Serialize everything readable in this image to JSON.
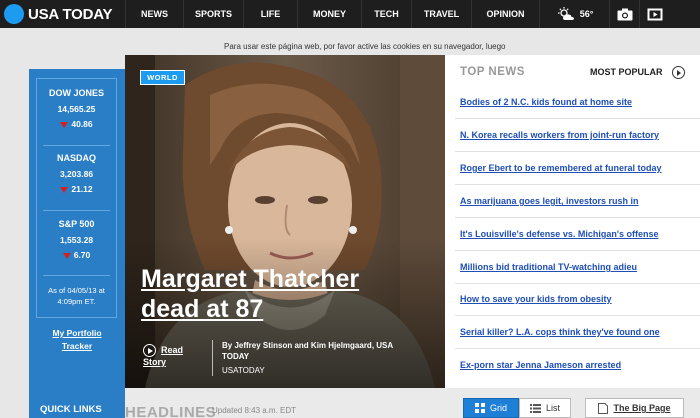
{
  "header": {
    "logo_text": "USA TODAY",
    "nav": [
      "NEWS",
      "SPORTS",
      "LIFE",
      "MONEY",
      "TECH",
      "TRAVEL",
      "OPINION"
    ],
    "weather_temp": "56°"
  },
  "ad_text": "Para usar este página web, por favor active las cookies en su navegador, luego",
  "markets": [
    {
      "name": "DOW JONES",
      "value": "14,565.25",
      "change": "40.86",
      "direction": "down"
    },
    {
      "name": "NASDAQ",
      "value": "3,203.86",
      "change": "21.12",
      "direction": "down"
    },
    {
      "name": "S&P 500",
      "value": "1,553.28",
      "change": "6.70",
      "direction": "down"
    }
  ],
  "markets_asof": [
    "As of 04/05/13 at",
    "4:09pm ET."
  ],
  "portfolio_link": [
    "My Portfolio",
    "Tracker"
  ],
  "quick_links": "QUICK LINKS",
  "hero": {
    "section": "WORLD",
    "headline_lines": [
      "Margaret Thatcher",
      "dead at 87"
    ],
    "read_story": [
      "Read",
      "Story"
    ],
    "byline": "By Jeffrey Stinson and Kim Hjelmgaard, USA TODAY",
    "source": "USATODAY"
  },
  "top_news": {
    "title": "TOP NEWS",
    "most_popular": "MOST POPULAR",
    "items": [
      "Bodies of 2 N.C. kids found at home site",
      "N. Korea recalls workers from joint-run factory",
      "Roger Ebert to be remembered at funeral today",
      "As marijuana goes legit, investors rush in",
      "It's Louisville's defense vs. Michigan's offense",
      "Millions bid traditional TV-watching adieu",
      "How to save your kids from obesity",
      "Serial killer? L.A. cops think they've found one",
      "Ex-porn star Jenna Jameson arrested"
    ]
  },
  "headlines": {
    "label": "HEADLINES",
    "updated": "Updated 8:43 a.m. EDT",
    "grid_label": "Grid",
    "list_label": "List",
    "big_page_label": "The Big Page"
  },
  "colors": {
    "nav_bg": "#1e1e1e",
    "brand_blue": "#1d9bf0",
    "sidebar_blue": "#2a7ec6",
    "link_blue": "#1f4fb5",
    "down_red": "#d62020"
  }
}
